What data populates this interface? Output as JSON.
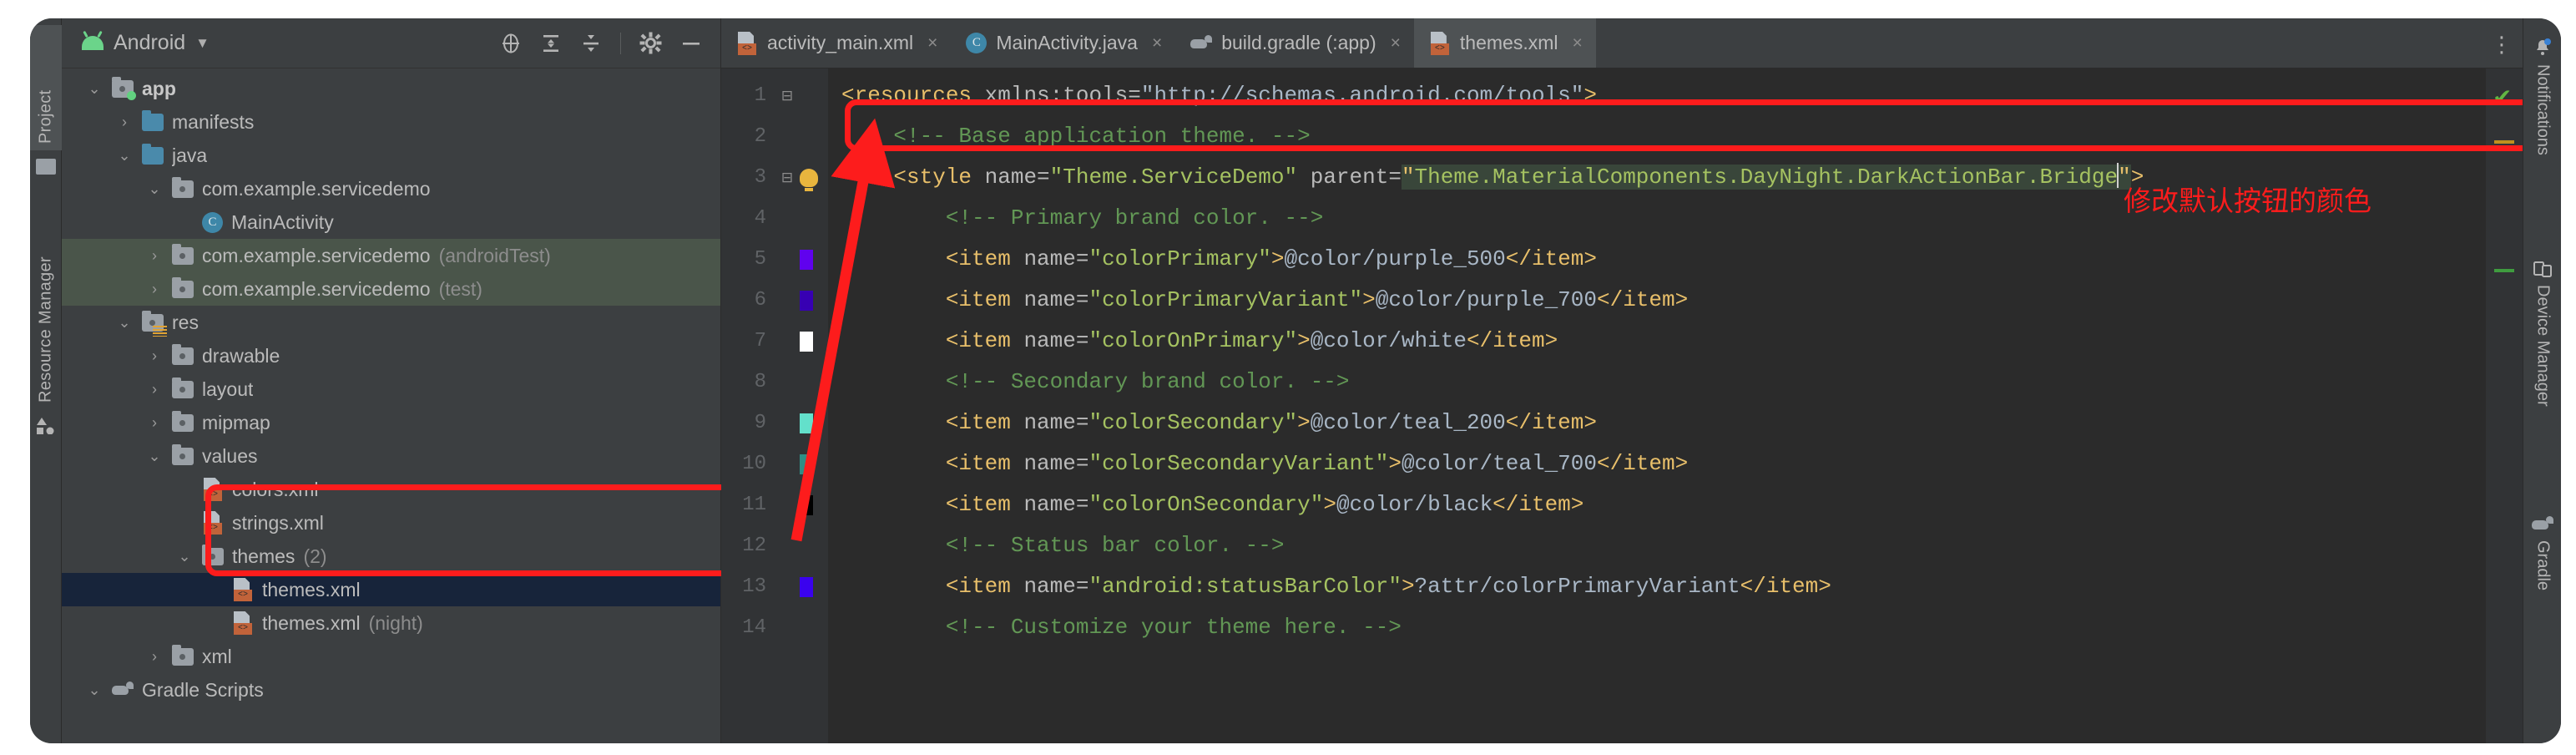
{
  "colors": {
    "accent_red": "#fd1c1c",
    "panel_bg": "#3c3f41",
    "editor_bg": "#2b2b2b",
    "selected_row": "#17243a",
    "test_source_row": "#4a554a",
    "folder_blue": "#4a8aab",
    "xml_chip": "#c1633a"
  },
  "left_strip": {
    "tabs": [
      {
        "label": "Project",
        "icon": "folder-icon",
        "active": true
      },
      {
        "label": "Resource Manager",
        "icon": "resource-manager-icon",
        "active": false
      }
    ]
  },
  "project_panel": {
    "header": {
      "title": "Android",
      "icon": "android-head-icon",
      "caret": "▼",
      "actions": [
        {
          "name": "select-opened-file-icon",
          "title": "Select Opened File"
        },
        {
          "name": "expand-all-icon",
          "title": "Expand All"
        },
        {
          "name": "collapse-all-icon",
          "title": "Collapse All"
        },
        {
          "name": "gear-icon",
          "title": "Settings"
        },
        {
          "name": "hide-icon",
          "title": "Hide"
        }
      ]
    },
    "tree": [
      {
        "label": "app",
        "indent": 0,
        "twisty": "v",
        "icon": "module-folder-icon",
        "bold": true,
        "state": "normal"
      },
      {
        "label": "manifests",
        "indent": 1,
        "twisty": ">",
        "icon": "folder-blue-icon",
        "bold": false,
        "state": "normal"
      },
      {
        "label": "java",
        "indent": 1,
        "twisty": "v",
        "icon": "folder-blue-icon",
        "bold": false,
        "state": "normal"
      },
      {
        "label": "com.example.servicedemo",
        "indent": 2,
        "twisty": "v",
        "icon": "package-folder-icon",
        "bold": false,
        "state": "normal"
      },
      {
        "label": "MainActivity",
        "indent": 3,
        "twisty": "",
        "icon": "java-class-icon",
        "bold": false,
        "state": "normal"
      },
      {
        "label": "com.example.servicedemo",
        "suffix": " (androidTest)",
        "indent": 2,
        "twisty": ">",
        "icon": "package-folder-icon",
        "bold": false,
        "state": "testsrc"
      },
      {
        "label": "com.example.servicedemo",
        "suffix": " (test)",
        "indent": 2,
        "twisty": ">",
        "icon": "package-folder-icon",
        "bold": false,
        "state": "testsrc"
      },
      {
        "label": "res",
        "indent": 1,
        "twisty": "v",
        "icon": "res-folder-icon",
        "bold": false,
        "state": "normal"
      },
      {
        "label": "drawable",
        "indent": 2,
        "twisty": ">",
        "icon": "package-folder-icon",
        "bold": false,
        "state": "normal"
      },
      {
        "label": "layout",
        "indent": 2,
        "twisty": ">",
        "icon": "package-folder-icon",
        "bold": false,
        "state": "normal"
      },
      {
        "label": "mipmap",
        "indent": 2,
        "twisty": ">",
        "icon": "package-folder-icon",
        "bold": false,
        "state": "normal"
      },
      {
        "label": "values",
        "indent": 2,
        "twisty": "v",
        "icon": "package-folder-icon",
        "bold": false,
        "state": "normal"
      },
      {
        "label": "colors.xml",
        "indent": 3,
        "twisty": "",
        "icon": "xml-file-icon",
        "bold": false,
        "state": "normal"
      },
      {
        "label": "strings.xml",
        "indent": 3,
        "twisty": "",
        "icon": "xml-file-icon",
        "bold": false,
        "state": "normal"
      },
      {
        "label": "themes",
        "suffix": " (2)",
        "indent": 3,
        "twisty": "v",
        "icon": "package-folder-icon",
        "bold": false,
        "state": "normal"
      },
      {
        "label": "themes.xml",
        "indent": 4,
        "twisty": "",
        "icon": "xml-file-icon",
        "bold": false,
        "state": "selected"
      },
      {
        "label": "themes.xml",
        "suffix": " (night)",
        "indent": 4,
        "twisty": "",
        "icon": "xml-file-icon",
        "bold": false,
        "state": "normal"
      },
      {
        "label": "xml",
        "indent": 2,
        "twisty": ">",
        "icon": "package-folder-icon",
        "bold": false,
        "state": "normal"
      },
      {
        "label": "Gradle Scripts",
        "indent": 0,
        "twisty": "v",
        "icon": "gradle-icon",
        "bold": false,
        "state": "normal"
      }
    ]
  },
  "editor": {
    "tabs": [
      {
        "label": "activity_main.xml",
        "icon": "xml-file-icon",
        "active": false,
        "close": "×"
      },
      {
        "label": "MainActivity.java",
        "icon": "java-class-icon",
        "active": false,
        "close": "×"
      },
      {
        "label": "build.gradle (:app)",
        "icon": "gradle-icon",
        "active": false,
        "close": "×"
      },
      {
        "label": "themes.xml",
        "icon": "xml-file-icon",
        "active": true,
        "close": "×"
      }
    ],
    "overflow_label": "⋮",
    "lines": [
      {
        "no": "1",
        "swatch": "",
        "fold": "−",
        "bulb": false
      },
      {
        "no": "2",
        "swatch": "",
        "fold": "",
        "bulb": false
      },
      {
        "no": "3",
        "swatch": "",
        "fold": "−",
        "bulb": true
      },
      {
        "no": "4",
        "swatch": "",
        "fold": "",
        "bulb": false
      },
      {
        "no": "5",
        "swatch": "#6002ee",
        "fold": "",
        "bulb": false
      },
      {
        "no": "6",
        "swatch": "#3700b3",
        "fold": "",
        "bulb": false
      },
      {
        "no": "7",
        "swatch": "#ffffff",
        "fold": "",
        "bulb": false
      },
      {
        "no": "8",
        "swatch": "",
        "fold": "",
        "bulb": false
      },
      {
        "no": "9",
        "swatch": "#63e0cb",
        "fold": "",
        "bulb": false
      },
      {
        "no": "10",
        "swatch": "#2f8e85",
        "fold": "",
        "bulb": false
      },
      {
        "no": "11",
        "swatch": "#000000",
        "fold": "",
        "bulb": false
      },
      {
        "no": "12",
        "swatch": "",
        "fold": "",
        "bulb": false
      },
      {
        "no": "13",
        "swatch": "#3a02ee",
        "fold": "",
        "bulb": false
      },
      {
        "no": "14",
        "swatch": "",
        "fold": "",
        "bulb": false
      }
    ],
    "code": {
      "l1_tag": "<resources",
      "l1_attr": " xmlns:tools=",
      "l1_val": "\"http://schemas.android.com/tools\"",
      "l1_close": ">",
      "l2": "    <!-- Base application theme. -->",
      "l3_tag": "    <style",
      "l3_attr1": " name=",
      "l3_val1": "\"Theme.ServiceDemo\"",
      "l3_attr2": " parent=",
      "l3_quote_open": "\"",
      "l3_val2_sel": "Theme.MaterialComponents.DayNight.DarkActionBar.Bridge",
      "l3_quote_close": "\"",
      "l3_close": ">",
      "l4": "        <!-- Primary brand color. -->",
      "l5_tag": "        <item",
      "l5_attr": " name=",
      "l5_val": "\"colorPrimary\"",
      "l5_gt": ">",
      "l5_text": "@color/purple_500",
      "l5_end": "</item>",
      "l6_tag": "        <item",
      "l6_attr": " name=",
      "l6_val": "\"colorPrimaryVariant\"",
      "l6_gt": ">",
      "l6_text": "@color/purple_700",
      "l6_end": "</item>",
      "l7_tag": "        <item",
      "l7_attr": " name=",
      "l7_val": "\"colorOnPrimary\"",
      "l7_gt": ">",
      "l7_text": "@color/white",
      "l7_end": "</item>",
      "l8": "        <!-- Secondary brand color. -->",
      "l9_tag": "        <item",
      "l9_attr": " name=",
      "l9_val": "\"colorSecondary\"",
      "l9_gt": ">",
      "l9_text": "@color/teal_200",
      "l9_end": "</item>",
      "l10_tag": "        <item",
      "l10_attr": " name=",
      "l10_val": "\"colorSecondaryVariant\"",
      "l10_gt": ">",
      "l10_text": "@color/teal_700",
      "l10_end": "</item>",
      "l11_tag": "        <item",
      "l11_attr": " name=",
      "l11_val": "\"colorOnSecondary\"",
      "l11_gt": ">",
      "l11_text": "@color/black",
      "l11_end": "</item>",
      "l12": "        <!-- Status bar color. -->",
      "l13_tag": "        <item",
      "l13_attr": " name=",
      "l13_val": "\"android:statusBarColor\"",
      "l13_gt": ">",
      "l13_text": "?attr/colorPrimaryVariant",
      "l13_end": "</item>",
      "l14": "        <!-- Customize your theme here. -->"
    }
  },
  "annotations": {
    "chinese_note": "修改默认按钮的颜色"
  },
  "right_strip": {
    "tabs": [
      {
        "label": "Notifications",
        "icon": "bell-icon"
      },
      {
        "label": "Device Manager",
        "icon": "device-manager-icon"
      },
      {
        "label": "Gradle",
        "icon": "gradle-icon"
      }
    ]
  }
}
